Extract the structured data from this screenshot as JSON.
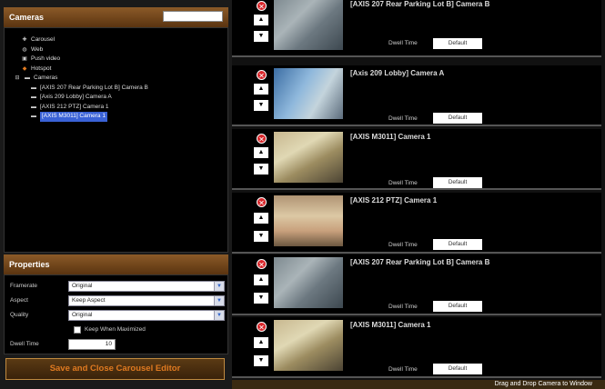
{
  "cameras_panel": {
    "title": "Cameras",
    "search_value": "",
    "tree": [
      {
        "label": "Carousel",
        "icon": "carousel-icon",
        "level": 1
      },
      {
        "label": "Web",
        "icon": "web-icon",
        "level": 1
      },
      {
        "label": "Push video",
        "icon": "push-video-icon",
        "level": 1
      },
      {
        "label": "Hotspot",
        "icon": "hotspot-icon",
        "level": 1
      },
      {
        "label": "Cameras",
        "icon": "camera-folder-icon",
        "level": 0
      },
      {
        "label": "[AXIS 207 Rear Parking Lot B] Camera B",
        "icon": "camera-icon",
        "level": 2
      },
      {
        "label": "[Axis 209 Lobby] Camera A",
        "icon": "camera-icon",
        "level": 2
      },
      {
        "label": "[AXIS 212 PTZ] Camera 1",
        "icon": "camera-icon",
        "level": 2
      },
      {
        "label": "[AXIS M3011] Camera 1",
        "icon": "camera-icon",
        "level": 2,
        "selected": true
      }
    ]
  },
  "properties_panel": {
    "title": "Properties",
    "framerate_label": "Framerate",
    "framerate_value": "Original",
    "aspect_label": "Aspect",
    "aspect_value": "Keep Aspect",
    "quality_label": "Quality",
    "quality_value": "Original",
    "keep_when_maximized_label": "Keep When Maximized",
    "dwell_time_label": "Dwell Time",
    "dwell_time_value": "10"
  },
  "save_button_label": "Save and Close Carousel Editor",
  "carousel_entries": [
    {
      "title": "[AXIS 207 Rear Parking Lot B] Camera B",
      "dwell_label": "Dwell Time",
      "dwell_value": "Default"
    },
    {
      "title": "[Axis 209 Lobby] Camera A",
      "dwell_label": "Dwell Time",
      "dwell_value": "Default"
    },
    {
      "title": "[AXIS M3011] Camera 1",
      "dwell_label": "Dwell Time",
      "dwell_value": "Default"
    },
    {
      "title": "[AXIS 212 PTZ] Camera 1",
      "dwell_label": "Dwell Time",
      "dwell_value": "Default"
    },
    {
      "title": "[AXIS 207 Rear Parking Lot B] Camera B",
      "dwell_label": "Dwell Time",
      "dwell_value": "Default"
    },
    {
      "title": "[AXIS M3011] Camera 1",
      "dwell_label": "Dwell Time",
      "dwell_value": "Default"
    }
  ],
  "bottom_bar_text": "Drag and Drop Camera to Window",
  "colors": {
    "accent": "#e07a20",
    "header": "#6e4418",
    "selection": "#3a62d6",
    "remove": "#d8262a"
  }
}
